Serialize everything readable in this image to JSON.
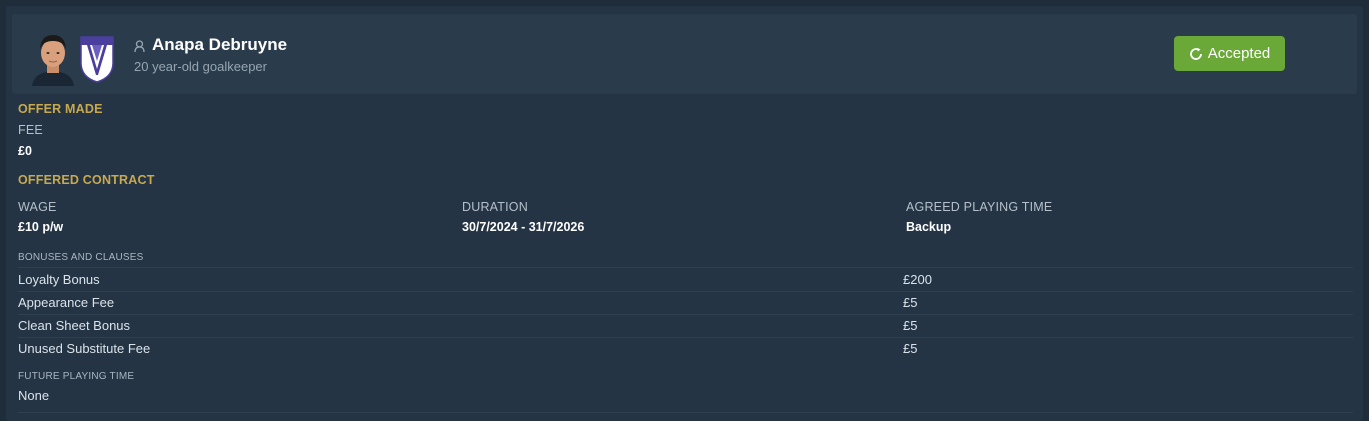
{
  "player": {
    "name": "Anapa Debruyne",
    "subtitle": "20 year-old goalkeeper",
    "status": "Accepted"
  },
  "offer_made": {
    "section_title": "OFFER MADE",
    "fee_label": "FEE",
    "fee_value": "£0"
  },
  "contract": {
    "section_title": "OFFERED CONTRACT",
    "wage_label": "WAGE",
    "wage_value": "£10 p/w",
    "duration_label": "DURATION",
    "duration_value": "30/7/2024 - 31/7/2026",
    "playing_time_label": "AGREED PLAYING TIME",
    "playing_time_value": "Backup"
  },
  "bonuses": {
    "title": "BONUSES AND CLAUSES",
    "items": [
      {
        "name": "Loyalty Bonus",
        "value": "£200"
      },
      {
        "name": "Appearance Fee",
        "value": "£5"
      },
      {
        "name": "Clean Sheet Bonus",
        "value": "£5"
      },
      {
        "name": "Unused Substitute Fee",
        "value": "£5"
      }
    ]
  },
  "future_playing_time": {
    "title": "FUTURE PLAYING TIME",
    "value": "None"
  },
  "colors": {
    "background": "#1f2d3a",
    "panel": "#243444",
    "header": "#2a3b4b",
    "section_gold": "#c9a94f",
    "accepted_green": "#6aa838"
  },
  "icons": {
    "person": "person-icon",
    "status": "refresh-icon",
    "club": "club-crest",
    "avatar": "player-avatar"
  }
}
